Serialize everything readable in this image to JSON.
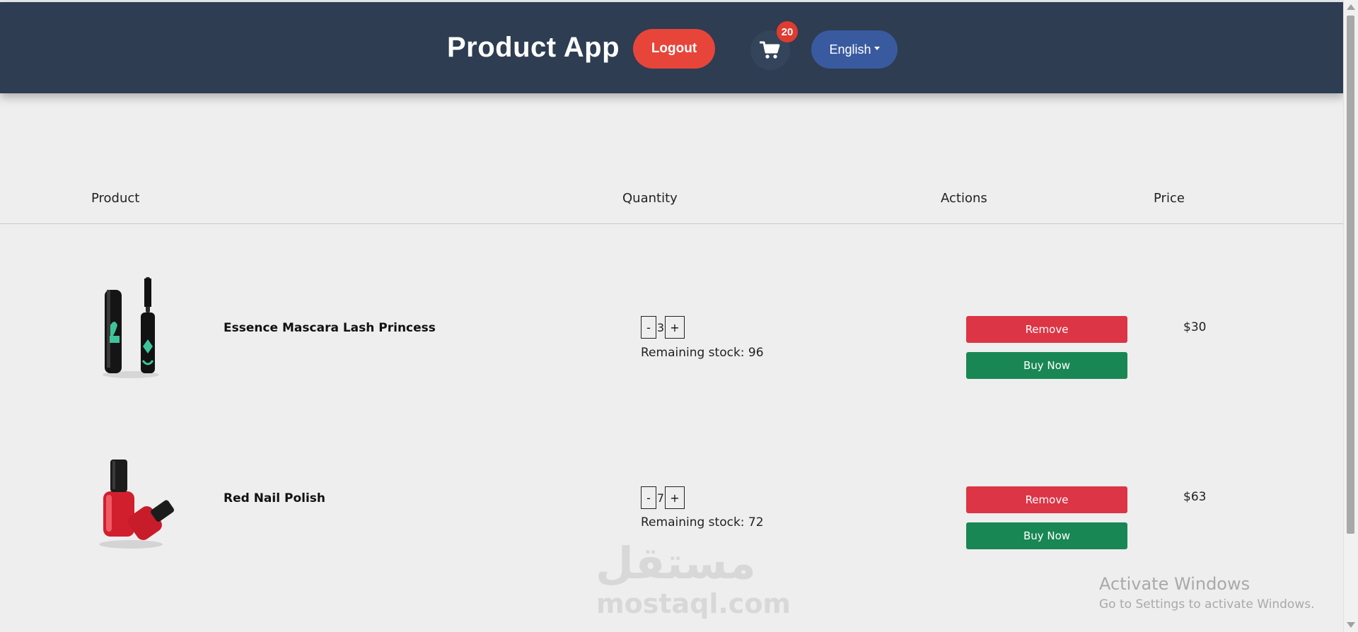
{
  "navbar": {
    "title": "Product App",
    "logout_label": "Logout",
    "cart_count": "20",
    "language_label": "English"
  },
  "table": {
    "headers": [
      "Product",
      "Quantity",
      "Actions",
      "Price"
    ],
    "rows": [
      {
        "name": "Essence Mascara Lash Princess",
        "quantity": "3",
        "stock_text": "Remaining stock: 96",
        "remove_label": "Remove",
        "buy_label": "Buy Now",
        "price": "$30"
      },
      {
        "name": "Red Nail Polish",
        "quantity": "7",
        "stock_text": "Remaining stock: 72",
        "remove_label": "Remove",
        "buy_label": "Buy Now",
        "price": "$63"
      }
    ]
  },
  "watermark": {
    "arabic": "مستقل",
    "latin": "mostaql.com"
  },
  "windows_notice": {
    "title": "Activate Windows",
    "subtitle": "Go to Settings to activate Windows."
  },
  "colors": {
    "navbar_bg": "#2e3d51",
    "logout": "#e8453a",
    "language": "#3a5aa0",
    "remove": "#dc3545",
    "buy": "#198754"
  }
}
